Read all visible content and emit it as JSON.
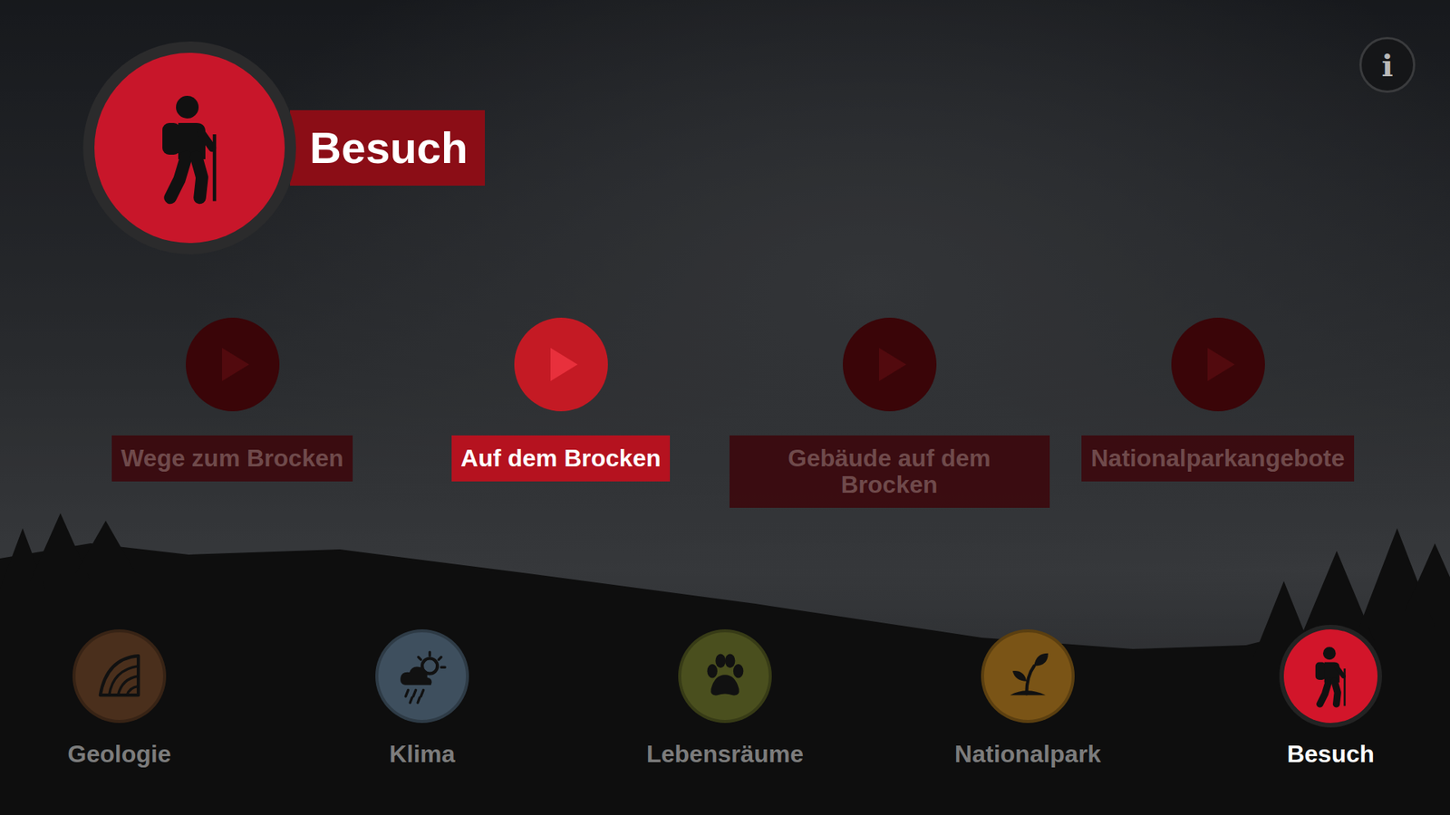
{
  "header": {
    "title": "Besuch",
    "kind": "hiker"
  },
  "info_button": {
    "label": "i"
  },
  "videos": [
    {
      "label": "Wege zum Brocken",
      "selected": false
    },
    {
      "label": "Auf dem Brocken",
      "selected": true
    },
    {
      "label": "Gebäude auf dem Brocken",
      "selected": false
    },
    {
      "label": "Nationalparkangebote",
      "selected": false
    }
  ],
  "nav": [
    {
      "label": "Geologie",
      "selected": false,
      "color": "#4a2f1c",
      "kind": "geology"
    },
    {
      "label": "Klima",
      "selected": false,
      "color": "#3e4f5e",
      "kind": "weather"
    },
    {
      "label": "Lebensräume",
      "selected": false,
      "color": "#4a4f1e",
      "kind": "paw"
    },
    {
      "label": "Nationalpark",
      "selected": false,
      "color": "#7a5416",
      "kind": "sprout"
    },
    {
      "label": "Besuch",
      "selected": true,
      "color": "#d2152a",
      "kind": "hiker"
    }
  ]
}
